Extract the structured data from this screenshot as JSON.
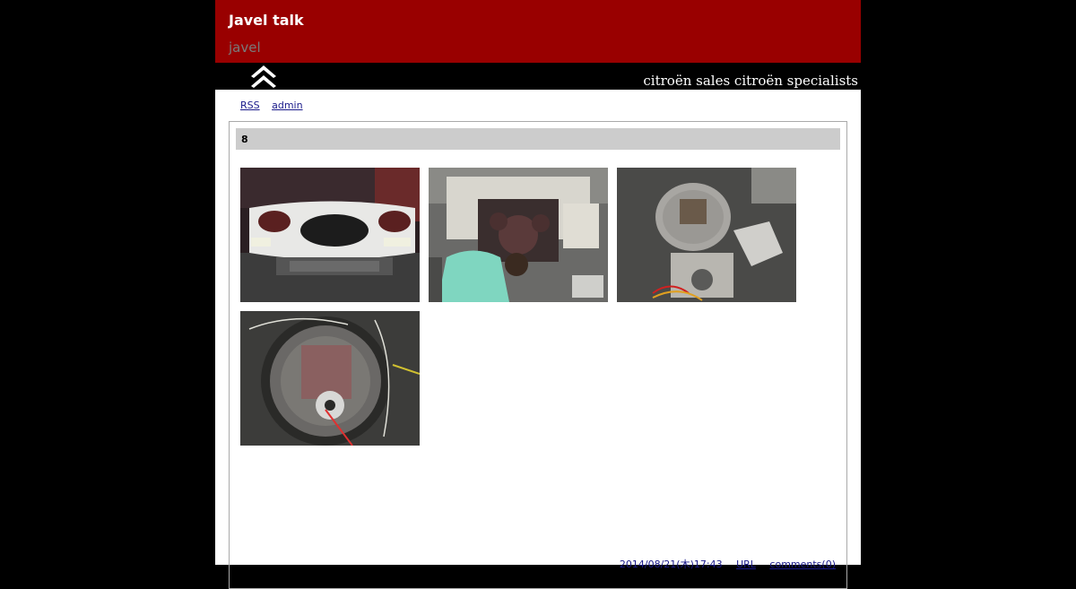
{
  "header": {
    "site_title": "Javel talk",
    "site_subtitle": "javel",
    "tagline": "citroën sales citroën specialists",
    "header_color": "#990000"
  },
  "nav": {
    "rss": "RSS",
    "admin": "admin"
  },
  "entry": {
    "title": "8",
    "photos": [
      {
        "subject": "white car front bumper panel"
      },
      {
        "subject": "mechanic working on car engine"
      },
      {
        "subject": "disassembled headlight housing"
      },
      {
        "subject": "round fan housing with wiring"
      }
    ],
    "footer": {
      "date": "2014/08/21(木)17:43",
      "url": "URL",
      "comments": "comments(0)"
    }
  }
}
